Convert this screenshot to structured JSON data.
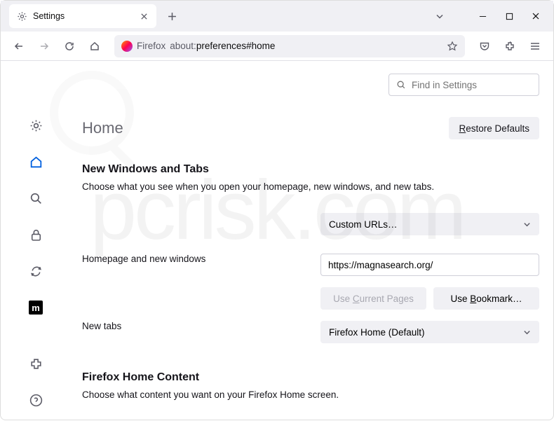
{
  "titlebar": {
    "tab_title": "Settings"
  },
  "toolbar": {
    "identity_label": "Firefox",
    "url_prefix": "about:",
    "url_path": "preferences#home"
  },
  "search": {
    "placeholder": "Find in Settings"
  },
  "header": {
    "title": "Home",
    "restore_label": "Restore Defaults",
    "restore_accesskey": "R"
  },
  "section_windows": {
    "title": "New Windows and Tabs",
    "desc": "Choose what you see when you open your homepage, new windows, and new tabs.",
    "homepage_label": "Homepage and new windows",
    "homepage_select": "Custom URLs…",
    "homepage_url_value": "https://magnasearch.org/",
    "use_current_label": "Use Current Pages",
    "use_current_accesskey": "C",
    "use_bookmark_label": "Use Bookmark…",
    "use_bookmark_accesskey": "B",
    "newtabs_label": "New tabs",
    "newtabs_select": "Firefox Home (Default)"
  },
  "section_content": {
    "title": "Firefox Home Content",
    "desc": "Choose what content you want on your Firefox Home screen."
  }
}
